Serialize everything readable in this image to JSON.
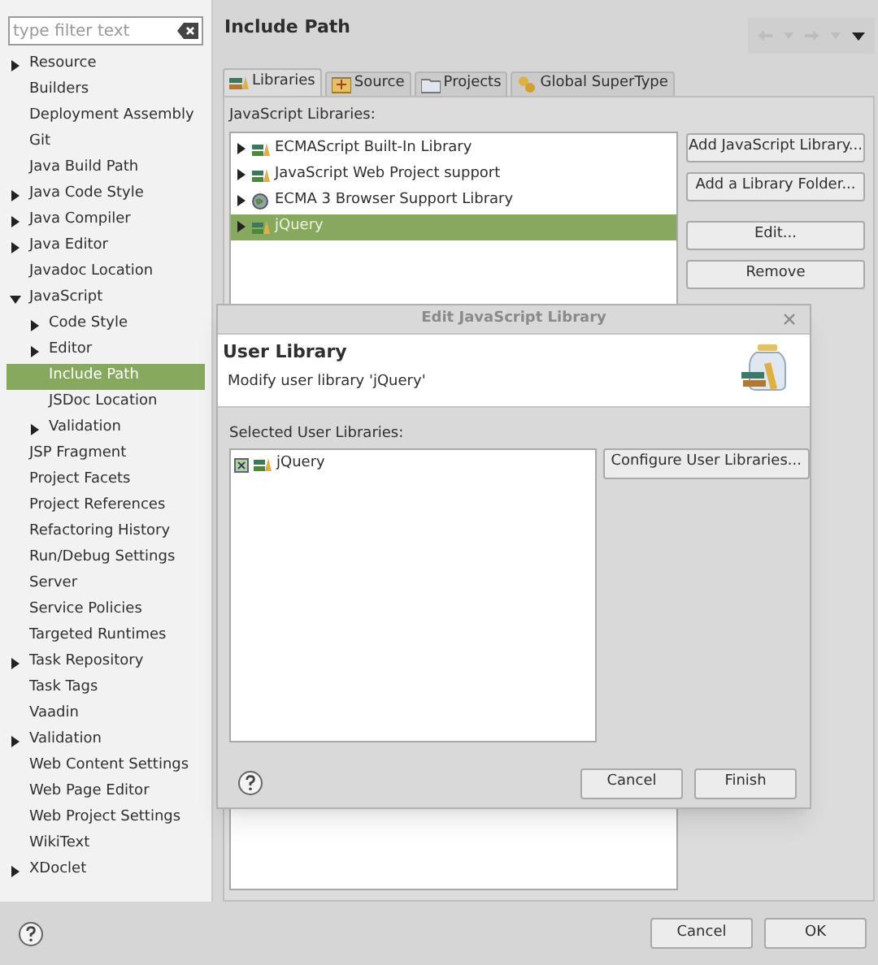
{
  "filter": {
    "placeholder": "type filter text"
  },
  "sidebar": {
    "items": [
      {
        "label": "Resource",
        "expandable": true,
        "expanded": false,
        "selected": false
      },
      {
        "label": "Builders",
        "expandable": false,
        "selected": false
      },
      {
        "label": "Deployment Assembly",
        "expandable": false,
        "selected": false
      },
      {
        "label": "Git",
        "expandable": false,
        "selected": false
      },
      {
        "label": "Java Build Path",
        "expandable": false,
        "selected": false
      },
      {
        "label": "Java Code Style",
        "expandable": true,
        "expanded": false,
        "selected": false
      },
      {
        "label": "Java Compiler",
        "expandable": true,
        "expanded": false,
        "selected": false
      },
      {
        "label": "Java Editor",
        "expandable": true,
        "expanded": false,
        "selected": false
      },
      {
        "label": "Javadoc Location",
        "expandable": false,
        "selected": false
      },
      {
        "label": "JavaScript",
        "expandable": true,
        "expanded": true,
        "selected": false,
        "children": [
          {
            "label": "Code Style",
            "expandable": true,
            "expanded": false,
            "selected": false
          },
          {
            "label": "Editor",
            "expandable": true,
            "expanded": false,
            "selected": false
          },
          {
            "label": "Include Path",
            "expandable": false,
            "selected": true
          },
          {
            "label": "JSDoc Location",
            "expandable": false,
            "selected": false
          },
          {
            "label": "Validation",
            "expandable": true,
            "expanded": false,
            "selected": false
          }
        ]
      },
      {
        "label": "JSP Fragment",
        "expandable": false,
        "selected": false
      },
      {
        "label": "Project Facets",
        "expandable": false,
        "selected": false
      },
      {
        "label": "Project References",
        "expandable": false,
        "selected": false
      },
      {
        "label": "Refactoring History",
        "expandable": false,
        "selected": false
      },
      {
        "label": "Run/Debug Settings",
        "expandable": false,
        "selected": false
      },
      {
        "label": "Server",
        "expandable": false,
        "selected": false
      },
      {
        "label": "Service Policies",
        "expandable": false,
        "selected": false
      },
      {
        "label": "Targeted Runtimes",
        "expandable": false,
        "selected": false
      },
      {
        "label": "Task Repository",
        "expandable": true,
        "expanded": false,
        "selected": false
      },
      {
        "label": "Task Tags",
        "expandable": false,
        "selected": false
      },
      {
        "label": "Vaadin",
        "expandable": false,
        "selected": false
      },
      {
        "label": "Validation",
        "expandable": true,
        "expanded": false,
        "selected": false
      },
      {
        "label": "Web Content Settings",
        "expandable": false,
        "selected": false
      },
      {
        "label": "Web Page Editor",
        "expandable": false,
        "selected": false
      },
      {
        "label": "Web Project Settings",
        "expandable": false,
        "selected": false
      },
      {
        "label": "WikiText",
        "expandable": false,
        "selected": false
      },
      {
        "label": "XDoclet",
        "expandable": true,
        "expanded": false,
        "selected": false
      }
    ]
  },
  "page": {
    "title": "Include Path",
    "tabs": [
      {
        "label": "Libraries",
        "kind": "libraries",
        "selected": true
      },
      {
        "label": "Source",
        "kind": "source",
        "selected": false
      },
      {
        "label": "Projects",
        "kind": "projects",
        "selected": false
      },
      {
        "label": "Global SuperType",
        "kind": "supertype",
        "selected": false
      }
    ],
    "list_label": "JavaScript Libraries:",
    "libraries": [
      {
        "label": "ECMAScript Built-In Library",
        "kind": "library",
        "selected": false
      },
      {
        "label": "JavaScript Web Project support",
        "kind": "library",
        "selected": false
      },
      {
        "label": "ECMA 3 Browser Support Library",
        "kind": "browser",
        "selected": false
      },
      {
        "label": "jQuery",
        "kind": "library",
        "selected": true
      }
    ],
    "buttons": [
      "Add JavaScript Library...",
      "Add a Library Folder...",
      "Edit...",
      "Remove"
    ]
  },
  "dialog": {
    "title": "Edit JavaScript Library",
    "header_title": "User Library",
    "header_message": "Modify user library 'jQuery'",
    "list_label": "Selected User Libraries:",
    "items": [
      {
        "label": "jQuery"
      }
    ],
    "side_button": "Configure User Libraries...",
    "buttons": [
      "Cancel",
      "Finish"
    ]
  },
  "footer": {
    "buttons": [
      "Cancel",
      "OK"
    ]
  }
}
